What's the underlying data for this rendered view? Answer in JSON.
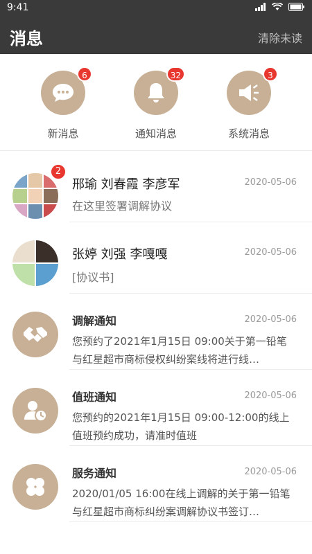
{
  "status_bar": {
    "time": "9:41"
  },
  "header": {
    "title": "消息",
    "clear_unread": "清除未读"
  },
  "quick": [
    {
      "label": "新消息",
      "badge": "6",
      "icon": "chat-bubble-icon"
    },
    {
      "label": "通知消息",
      "badge": "32",
      "icon": "bell-icon"
    },
    {
      "label": "系统消息",
      "badge": "3",
      "icon": "megaphone-icon"
    }
  ],
  "conversations": [
    {
      "title": "邢瑜  刘春霞  李彦军",
      "subtitle": "在这里签署调解协议",
      "date": "2020-05-06",
      "badge": "2"
    },
    {
      "title": "张婷  刘强   李嘎嘎",
      "subtitle": "[协议书]",
      "date": "2020-05-06"
    }
  ],
  "notifications": [
    {
      "title": "调解通知",
      "date": "2020-05-06",
      "body": "您预约了2021年1月15日  09:00关于第一铅笔与红星超市商标侵权纠纷案线将进行线…",
      "icon": "handshake-icon"
    },
    {
      "title": "值班通知",
      "date": "2020-05-06",
      "body": "您预约的2021年1月15日 09:00-12:00的线上值班预约成功，请准时值班",
      "icon": "user-clock-icon"
    },
    {
      "title": "服务通知",
      "date": "2020-05-06",
      "body": "2020/01/05  16:00在线上调解的关于第一铅笔与红星超市商标纠纷案调解协议书签订…",
      "icon": "clover-icon"
    }
  ],
  "colors": {
    "header_bg": "#3a3a3a",
    "accent": "#c7b095",
    "badge": "#e8372f"
  }
}
